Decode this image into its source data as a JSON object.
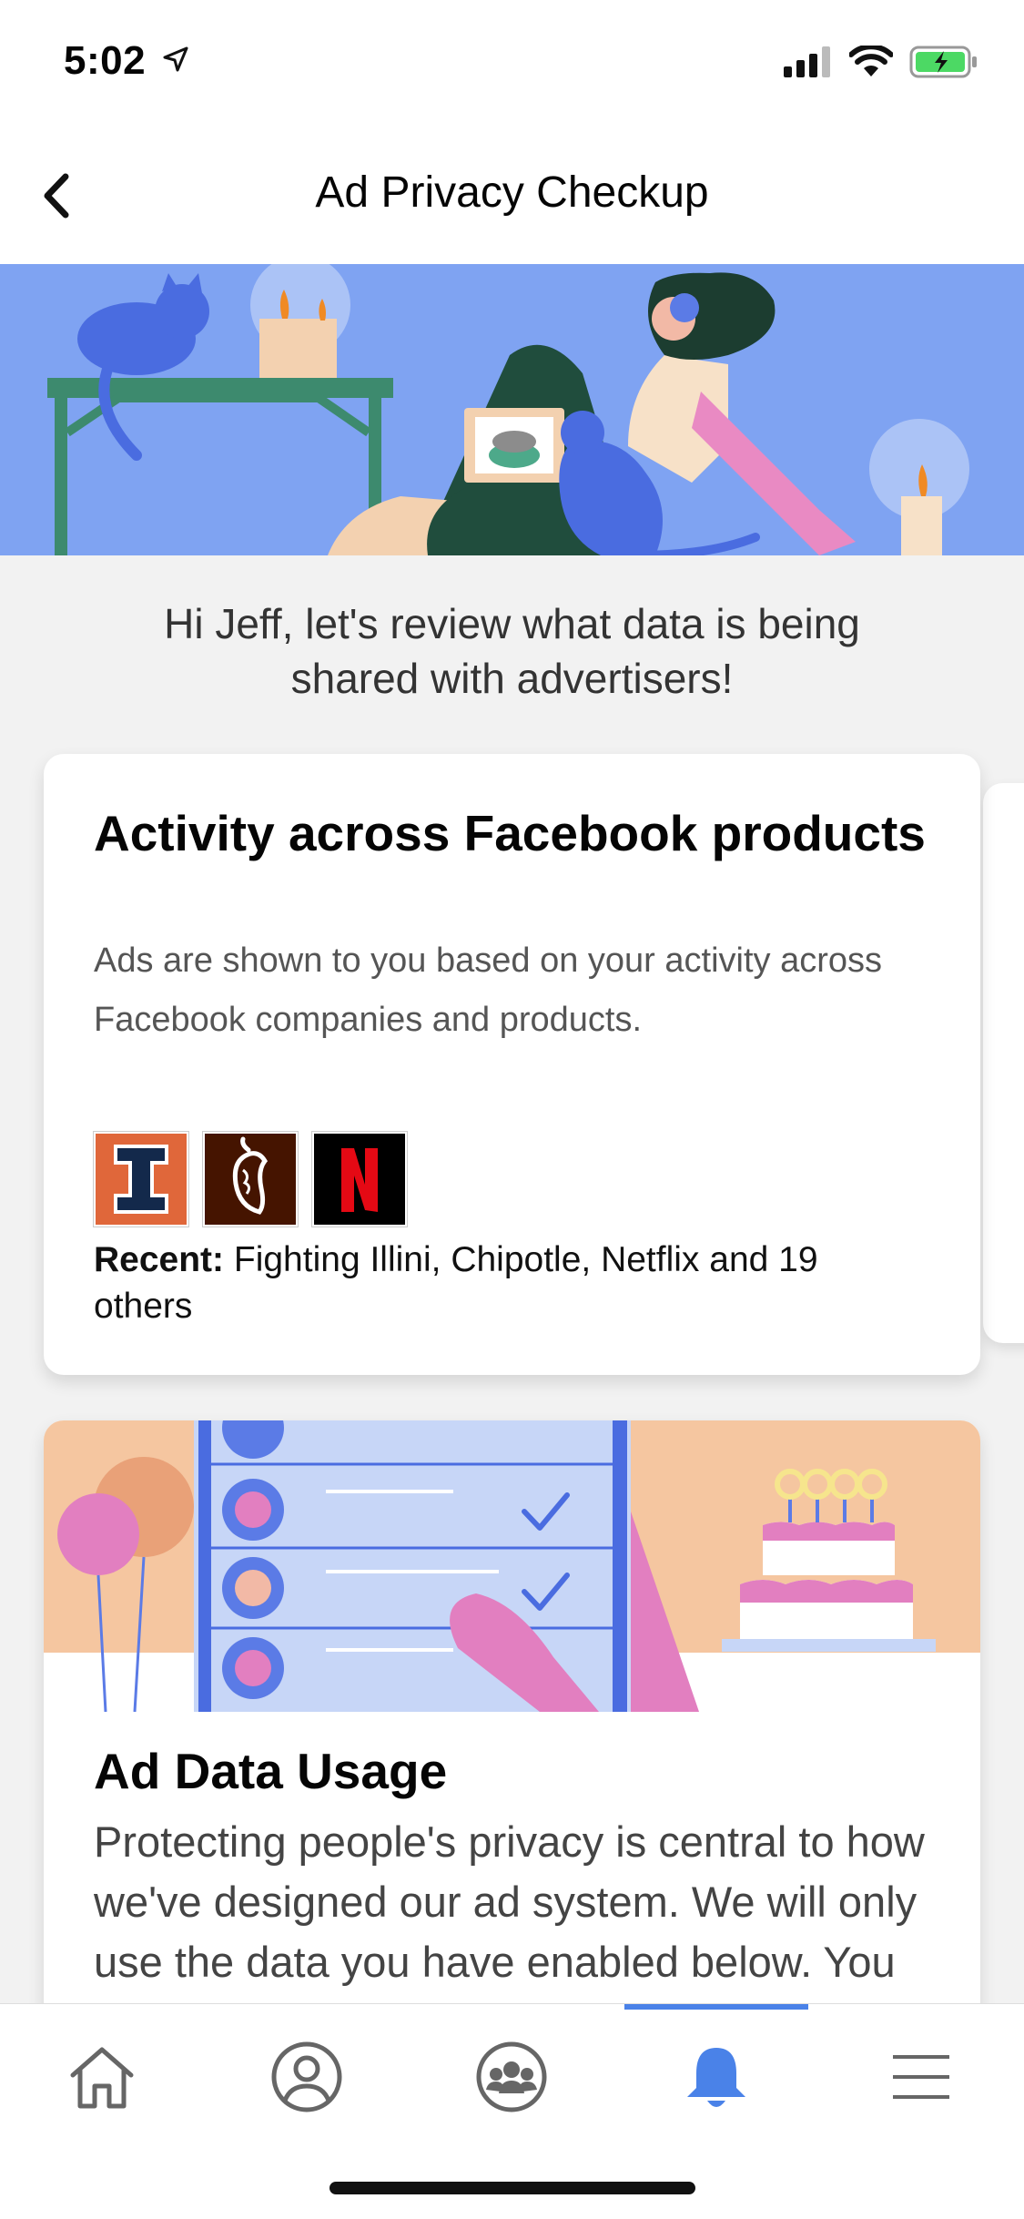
{
  "status": {
    "time": "5:02"
  },
  "nav": {
    "title": "Ad Privacy Checkup"
  },
  "intro": "Hi Jeff, let's review what data is being shared with advertisers!",
  "card1": {
    "title": "Activity across Facebook products",
    "description": "Ads are shown to you based on your activity across Facebook companies and products.",
    "recent_label": "Recent:",
    "recent_text": " Fighting Illini, Chipotle, Netflix and 19 others",
    "logos": [
      {
        "name": "illini-logo",
        "letter": "I",
        "bg": "#e0673a",
        "fg": "#13294b"
      },
      {
        "name": "chipotle-logo",
        "letter": "",
        "bg": "#451400",
        "fg": "#ffffff"
      },
      {
        "name": "netflix-logo",
        "letter": "N",
        "bg": "#000000",
        "fg": "#e50914"
      }
    ]
  },
  "card2": {
    "title": "Ad Data Usage",
    "description": "Protecting people's privacy is central to how we've designed our ad system. We will only use the data you have enabled below. You will still see the same number of ads."
  },
  "tabs": [
    {
      "name": "home-tab",
      "icon": "home-icon",
      "active": false
    },
    {
      "name": "profile-tab",
      "icon": "profile-icon",
      "active": false
    },
    {
      "name": "groups-tab",
      "icon": "groups-icon",
      "active": false
    },
    {
      "name": "notifications-tab",
      "icon": "bell-icon",
      "active": true
    },
    {
      "name": "menu-tab",
      "icon": "menu-icon",
      "active": false
    }
  ],
  "colors": {
    "accent": "#4a82e8",
    "hero": "#7fa3f2",
    "peach": "#f5c6a0"
  }
}
